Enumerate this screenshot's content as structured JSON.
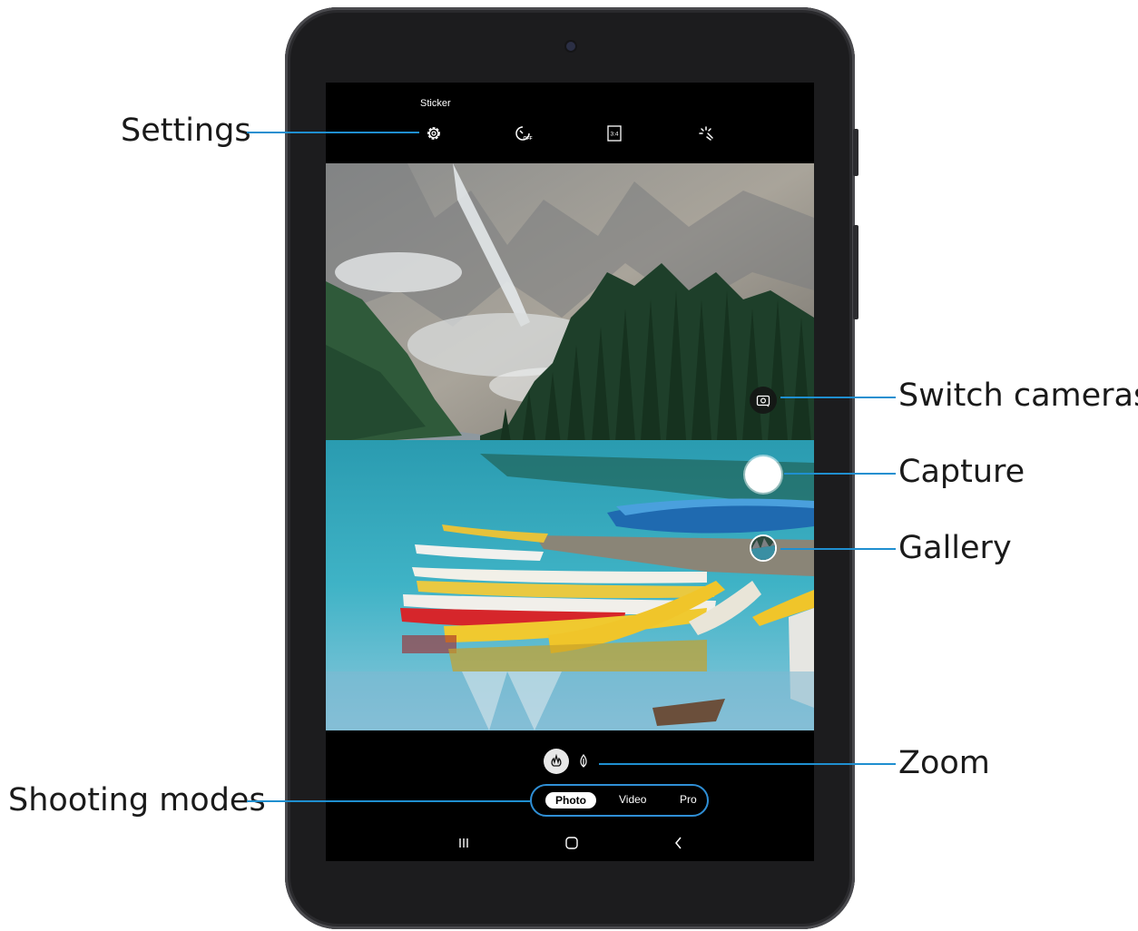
{
  "top_bar": {
    "sticker_label": "Sticker",
    "icons": [
      "settings-icon",
      "timer-off-icon",
      "aspect-ratio-icon",
      "flash-icon"
    ],
    "ratio_text": "3:4",
    "timer_text": "OFF"
  },
  "viewfinder": {
    "side_controls": [
      "switch-cameras-icon",
      "capture-button",
      "gallery-thumbnail"
    ]
  },
  "zoom": {
    "options": [
      "wide-angle-icon",
      "tele-icon"
    ]
  },
  "modes": {
    "items": [
      "Photo",
      "Video",
      "Pro"
    ],
    "selected": "Photo"
  },
  "nav": {
    "icons": [
      "recent-apps-icon",
      "home-icon",
      "back-icon"
    ]
  },
  "callouts": {
    "settings": "Settings",
    "switch_cameras": "Switch cameras",
    "capture": "Capture",
    "gallery": "Gallery",
    "zoom": "Zoom",
    "shooting_modes": "Shooting modes"
  },
  "colors": {
    "callout_line": "#1f8fd0",
    "modes_outline": "#2f8fd6",
    "device": "#1c1c1e"
  }
}
